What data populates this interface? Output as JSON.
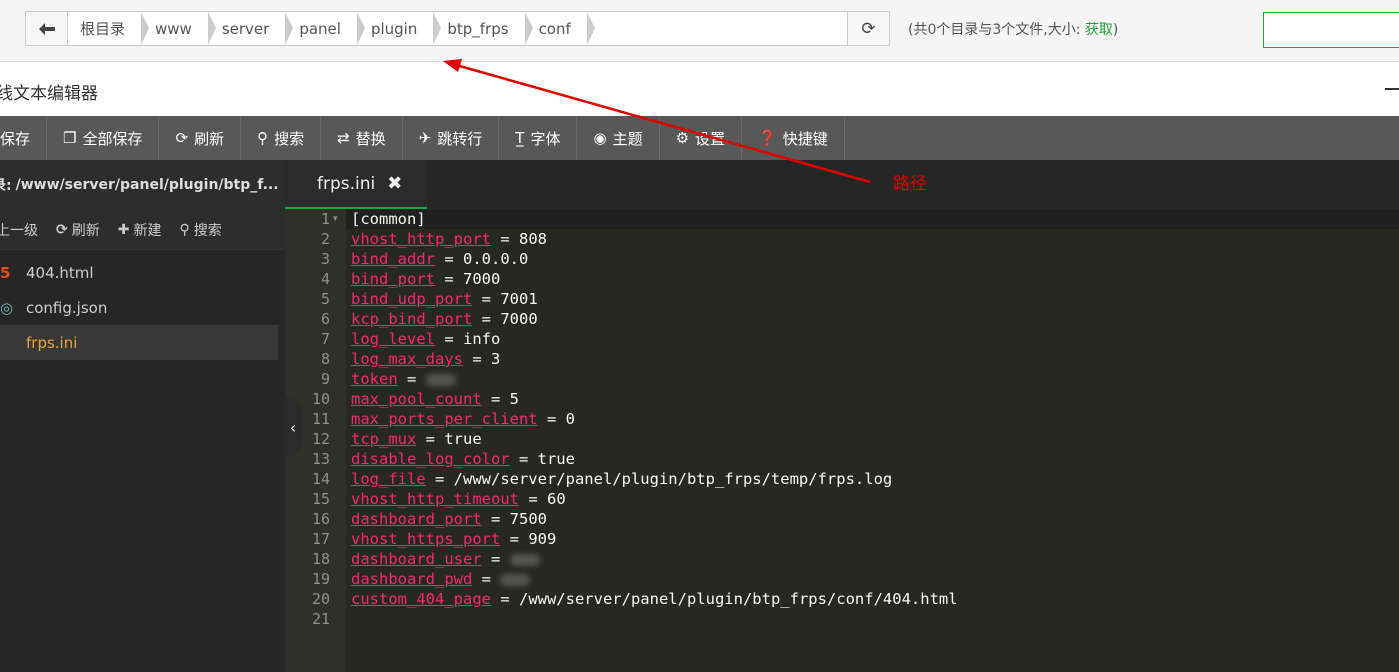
{
  "breadcrumb": {
    "items": [
      "根目录",
      "www",
      "server",
      "panel",
      "plugin",
      "btp_frps",
      "conf"
    ]
  },
  "dir_info": {
    "text": "(共0个目录与3个文件,大小: ",
    "link": "获取",
    "suffix": ")"
  },
  "editor": {
    "title": "线文本编辑器"
  },
  "toolbar": {
    "buttons": [
      {
        "icon": "save-icon",
        "label": "保存"
      },
      {
        "icon": "save-all-icon",
        "label": "全部保存"
      },
      {
        "icon": "refresh-icon",
        "label": "刷新"
      },
      {
        "icon": "search-icon",
        "label": "搜索"
      },
      {
        "icon": "replace-icon",
        "label": "替换"
      },
      {
        "icon": "goto-icon",
        "label": "跳转行"
      },
      {
        "icon": "font-icon",
        "label": "字体"
      },
      {
        "icon": "theme-icon",
        "label": "主题"
      },
      {
        "icon": "gear-icon",
        "label": "设置"
      },
      {
        "icon": "help-icon",
        "label": "快捷键"
      }
    ]
  },
  "sidebar": {
    "path_label": "录:",
    "path": "/www/server/panel/plugin/btp_f...",
    "actions": [
      "上一级",
      "刷新",
      "新建",
      "搜索"
    ],
    "files": [
      {
        "name": "404.html",
        "icon": "html5-icon",
        "active": false
      },
      {
        "name": "config.json",
        "icon": "json-icon",
        "active": false
      },
      {
        "name": "frps.ini",
        "icon": "file-icon",
        "active": true
      }
    ]
  },
  "tabs": [
    {
      "label": "frps.ini",
      "close": "✖"
    }
  ],
  "code_lines": [
    {
      "n": "1",
      "key": "",
      "value": "[common]"
    },
    {
      "n": "2",
      "key": "vhost_http_port",
      "value": "808"
    },
    {
      "n": "3",
      "key": "bind_addr",
      "value": "0.0.0.0"
    },
    {
      "n": "4",
      "key": "bind_port",
      "value": "7000"
    },
    {
      "n": "5",
      "key": "bind_udp_port",
      "value": "7001"
    },
    {
      "n": "6",
      "key": "kcp_bind_port",
      "value": "7000"
    },
    {
      "n": "7",
      "key": "log_level",
      "value": "info"
    },
    {
      "n": "8",
      "key": "log_max_days",
      "value": "3"
    },
    {
      "n": "9",
      "key": "token",
      "value": ""
    },
    {
      "n": "10",
      "key": "max_pool_count",
      "value": "5"
    },
    {
      "n": "11",
      "key": "max_ports_per_client",
      "value": "0"
    },
    {
      "n": "12",
      "key": "tcp_mux",
      "value": "true"
    },
    {
      "n": "13",
      "key": "disable_log_color",
      "value": "true"
    },
    {
      "n": "14",
      "key": "log_file",
      "value": "/www/server/panel/plugin/btp_frps/temp/frps.log"
    },
    {
      "n": "15",
      "key": "vhost_http_timeout",
      "value": "60"
    },
    {
      "n": "16",
      "key": "dashboard_port",
      "value": "7500"
    },
    {
      "n": "17",
      "key": "vhost_https_port",
      "value": "909"
    },
    {
      "n": "18",
      "key": "dashboard_user",
      "value": ""
    },
    {
      "n": "19",
      "key": "dashboard_pwd",
      "value": ""
    },
    {
      "n": "20",
      "key": "custom_404_page",
      "value": "/www/server/panel/plugin/btp_frps/conf/404.html"
    },
    {
      "n": "21",
      "key": "",
      "value": ""
    }
  ],
  "annotation": {
    "label": "路径",
    "color": "#e00000"
  }
}
